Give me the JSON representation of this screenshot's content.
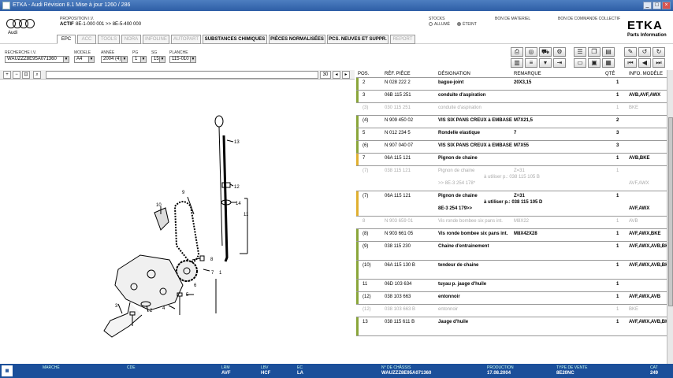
{
  "window": {
    "title": "ETKA - Audi Révision 8.1 Mise à jour 1260 / 286"
  },
  "header": {
    "brand": "Audi",
    "proposition_label": "PROPOSITION I.V.",
    "actif_label": "ACTIF",
    "actif_value": "8E-1-000 001 >> 8E-5-400 000",
    "stocks_label": "STOCKS",
    "stock_on": "ALLUMÉ",
    "stock_off": "ÉTEINT",
    "bon_materiel": "BON DE MATERIEL",
    "bon_collectif": "BON DE COMMANDE COLLECTIF",
    "logo": "ETKA",
    "logo_sub": "Parts Information"
  },
  "tabs": [
    {
      "label": "EPC",
      "state": "active"
    },
    {
      "label": "ACC",
      "state": "disabled"
    },
    {
      "label": "TOOLS",
      "state": "disabled"
    },
    {
      "label": "NORA",
      "state": "disabled"
    },
    {
      "label": "INFOLINE",
      "state": "disabled"
    },
    {
      "label": "AUTOPART",
      "state": "disabled"
    },
    {
      "label": "SUBSTANCES CHIMIQUES",
      "state": "enabled"
    },
    {
      "label": "PIÈCES NORMALISÉES",
      "state": "enabled"
    },
    {
      "label": "PCS. NEUVES ET SUPPR.",
      "state": "enabled"
    },
    {
      "label": "REPORT",
      "state": "disabled"
    }
  ],
  "filters": {
    "recherche_label": "RECHERCHE I.V.",
    "recherche_value": "WAUZZZ8E95A071360",
    "modele_label": "MODELE",
    "modele_value": "A4",
    "annee_label": "ANNÉE",
    "annee_value": "2004 (4)",
    "pg_label": "PG",
    "pg_value": "1",
    "sg_label": "SG",
    "sg_value": "15",
    "planche_label": "PLANCHE",
    "planche_value": "115-010"
  },
  "imgtool": {
    "zoom_value": "30"
  },
  "diagram_labels": [
    {
      "n": "13"
    },
    {
      "n": "12"
    },
    {
      "n": "14"
    },
    {
      "n": "11"
    },
    {
      "n": "9"
    },
    {
      "n": "10"
    },
    {
      "n": "8"
    },
    {
      "n": "7"
    },
    {
      "n": "1"
    },
    {
      "n": "6"
    },
    {
      "n": "5"
    },
    {
      "n": "4"
    },
    {
      "n": "3"
    },
    {
      "n": "2"
    }
  ],
  "table": {
    "headers": {
      "pos": "POS.",
      "ref": "RÉF. PIÈCE",
      "desig": "DÉSIGNATION",
      "rem": "REMARQUE",
      "qte": "QTÉ",
      "info": "INFO. MODÈLE"
    },
    "rows": [
      {
        "pos": "2",
        "ref": "N 028 222 2",
        "desig": "bague-joint",
        "rem": "20X3,15",
        "qte": "1",
        "info": "",
        "style": "n"
      },
      {
        "pos": "3",
        "ref": "06B 115 251",
        "desig": "conduite d'aspiration",
        "rem": "",
        "qte": "1",
        "info": "AVB,AVF,AWX",
        "style": "n"
      },
      {
        "pos": "(3)",
        "ref": "030 115 251",
        "desig": "conduite d'aspiration",
        "rem": "",
        "qte": "1",
        "info": "BKE",
        "style": "g"
      },
      {
        "pos": "(4)",
        "ref": "N 909 450 02",
        "desig": "VIS SIX PANS CREUX à EMBASE",
        "rem": "M7X21,5",
        "qte": "2",
        "info": "",
        "style": "n"
      },
      {
        "pos": "5",
        "ref": "N 012 234 5",
        "desig": "Rondelle elastique",
        "rem": "7",
        "qte": "3",
        "info": "",
        "style": "n"
      },
      {
        "pos": "(6)",
        "ref": "N 907 040 07",
        "desig": "VIS SIX PANS CREUX à EMBASE",
        "rem": "M7X55",
        "qte": "3",
        "info": "",
        "style": "n"
      },
      {
        "pos": "7",
        "ref": "06A 115 121",
        "desig": "Pignon de chaine",
        "rem": "",
        "qte": "1",
        "info": "AVB,BKE",
        "style": "y"
      },
      {
        "pos": "(7)",
        "ref": "038 115 121",
        "desig": "Pignon de chaine",
        "rem": "Z=31",
        "rem2": "à utiliser p.: 038 115 105 B",
        "rem3": ">> 8E-3 254 178*",
        "qte": "1",
        "info": "AVF,AWX",
        "style": "g"
      },
      {
        "pos": "(7)",
        "ref": "06A 115 121",
        "desig": "Pignon de chaine",
        "rem": "Z=31",
        "rem2": "à utiliser p.: 038 115 105 D",
        "rem3": "8E-3 254 179>>",
        "qte": "1",
        "info": "AVF,AWX",
        "style": "y"
      },
      {
        "pos": "8",
        "ref": "N 903 659 01",
        "desig": "Vis ronde bombee six pans int.",
        "rem": "M8X22",
        "qte": "1",
        "info": "AVB",
        "style": "g"
      },
      {
        "pos": "(8)",
        "ref": "N 903 661 05",
        "desig": "Vis ronde bombee six pans int.",
        "rem": "M8X42X28",
        "qte": "1",
        "info": "AVF,AWX,BKE",
        "style": "n"
      },
      {
        "pos": "(9)",
        "ref": "038 115 230",
        "desig": "Chaine d'entrainement",
        "rem": "",
        "qte": "1",
        "info": "AVF,AWX,AVB,BKE",
        "style": "n"
      },
      {
        "pos": "(10)",
        "ref": "06A 115 130 B",
        "desig": "tendeur de chaine",
        "rem": "",
        "qte": "1",
        "info": "AVF,AWX,AVB,BKE",
        "style": "n"
      },
      {
        "pos": "11",
        "ref": "06D 103 634",
        "desig": "tuyau p. jauge d'huile",
        "rem": "",
        "qte": "1",
        "info": "",
        "style": "n"
      },
      {
        "pos": "(12)",
        "ref": "038 103 663",
        "desig": "entonnoir",
        "rem": "",
        "qte": "1",
        "info": "AVF,AWX,AVB",
        "style": "n"
      },
      {
        "pos": "(12)",
        "ref": "038 103 663 B",
        "desig": "entonnoir",
        "rem": "",
        "qte": "1",
        "info": "BKE",
        "style": "g"
      },
      {
        "pos": "13",
        "ref": "038 115 611 B",
        "desig": "Jauge d'huile",
        "rem": "",
        "qte": "1",
        "info": "AVF,AWX,AVB,BKE",
        "style": "n"
      }
    ]
  },
  "status": {
    "marche_label": "MARCHÉ",
    "marche": "",
    "ode_label": "CDE",
    "ode": "",
    "lrm_label": "LRM",
    "lrm": "AVF",
    "lbv_label": "LBV",
    "lbv": "HCF",
    "ec_label": "EC",
    "ec": "LA",
    "chassis_label": "N° DE CHÂSSIS",
    "chassis": "WAUZZZ8E95A071360",
    "production_label": "PRODUCTION",
    "production": "17.08.2004",
    "vente_label": "TYPE DE VENTE",
    "vente": "8E20NC",
    "cat_label": "CAT",
    "cat": "249"
  }
}
